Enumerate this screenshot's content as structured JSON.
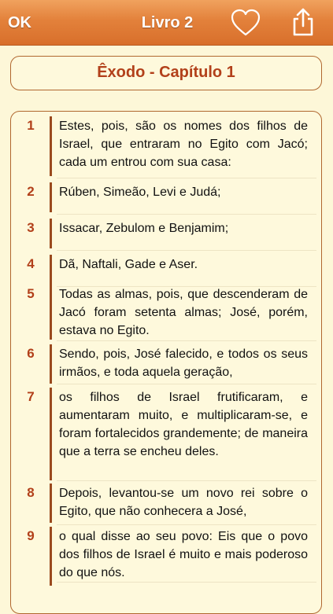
{
  "toolbar": {
    "ok_label": "OK",
    "title": "Livro 2",
    "heart_icon": "heart-outline-icon",
    "share_icon": "share-icon"
  },
  "chapter": {
    "heading": "Êxodo - Capítulo 1"
  },
  "verses": [
    {
      "num": "1",
      "text": "Estes, pois, são os nomes dos filhos de Israel, que entraram no Egito com Jacó; cada um entrou com sua casa:"
    },
    {
      "num": "2",
      "text": "Rúben, Simeão, Levi e Judá;"
    },
    {
      "num": "3",
      "text": "Issacar, Zebulom e Benjamim;"
    },
    {
      "num": "4",
      "text": "Dã, Naftali, Gade e Aser."
    },
    {
      "num": "5",
      "text": "Todas as almas, pois, que descenderam de Jacó foram setenta almas; José, porém, estava no Egito."
    },
    {
      "num": "6",
      "text": "Sendo, pois, José falecido, e todos os seus irmãos, e toda aquela geração,"
    },
    {
      "num": "7",
      "text": "os filhos de Israel frutificaram, e aumentaram muito, e multiplicaram-se, e foram fortalecidos grandemente; de maneira que a terra se encheu deles."
    },
    {
      "num": "8",
      "text": "Depois, levantou-se um novo rei sobre o Egito, que não conhecera a José,"
    },
    {
      "num": "9",
      "text": "o qual disse ao seu povo: Eis que o povo dos filhos de Israel é muito e mais poderoso do que nós."
    }
  ],
  "colors": {
    "toolbar": "#e3813b",
    "accent": "#b2401a",
    "background": "#fdf7d8"
  }
}
